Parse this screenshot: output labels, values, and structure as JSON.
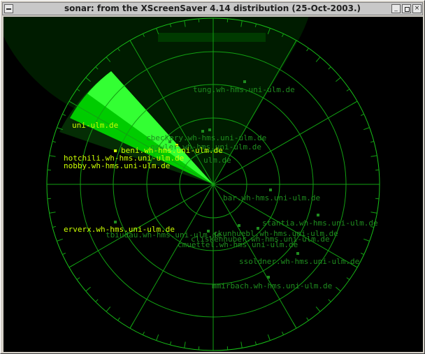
{
  "window": {
    "title": "sonar: from the XScreenSaver 4.14 distribution (25-Oct-2003.)",
    "buttons": {
      "minimize": "_",
      "maximize": "",
      "close": "×"
    }
  },
  "colors": {
    "background": "#000000",
    "grid": "#0a8c0a",
    "grid_bright": "#18c018",
    "dim_label": "#1f8c1f",
    "bright_label": "#ccff00",
    "sweep": "#00ff00"
  },
  "sonar": {
    "hosts": [
      {
        "label": "tung.wh-hms.uni-ulm.de",
        "bright": false
      },
      {
        "label": "uni-ulm.de",
        "bright": true
      },
      {
        "label": "beni.wh-hms.uni-ulm.de",
        "bright": true
      },
      {
        "label": "hotchili.wh-hms.uni-ulm.de",
        "bright": true
      },
      {
        "label": "nobby.wh-hms.uni-ulm.de",
        "bright": true
      },
      {
        "label": "cbeckery.wh-hms.uni-ulm.de",
        "bright": false
      },
      {
        "label": "gowler.wh-hms.uni-ulm.de",
        "bright": false
      },
      {
        "label": "ulm.de",
        "bright": false
      },
      {
        "label": "bar.wh-hms.uni-ulm.de",
        "bright": false
      },
      {
        "label": "stantia.wh-hms.uni-ulm.de",
        "bright": false
      },
      {
        "label": "erverx.wh-hms.uni-ulm.de",
        "bright": true
      },
      {
        "label": "tbiudau.wh-hms.uni-ulm.de",
        "bright": false
      },
      {
        "label": "ckunhuebl.wh-hms.uni-ulm.de",
        "bright": false
      },
      {
        "label": "cliskenhuber.wh-hms.uni-ulm.de",
        "bright": false
      },
      {
        "label": "cmuettel.wh-hms.uni-ulm.de",
        "bright": false
      },
      {
        "label": "ssoldner.wh-hms.uni-ulm.de",
        "bright": false
      },
      {
        "label": "mmirbach.wh-hms.uni-ulm.de",
        "bright": false
      }
    ]
  }
}
